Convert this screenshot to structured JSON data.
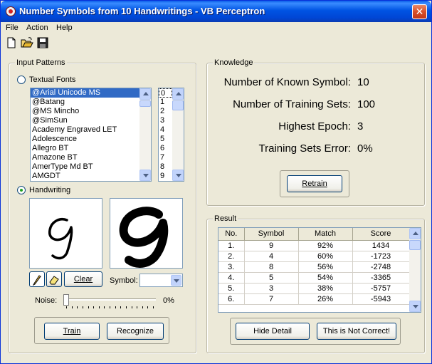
{
  "window": {
    "title": "Number Symbols from 10 Handwritings - VB Perceptron",
    "close_glyph": "✕"
  },
  "menu": {
    "file": "File",
    "action": "Action",
    "help": "Help"
  },
  "toolbar": {
    "icons": [
      "new-file-icon",
      "open-folder-icon",
      "save-disk-icon"
    ]
  },
  "input_patterns": {
    "legend": "Input Patterns",
    "textual_fonts_label": "Textual Fonts",
    "fonts": [
      "@Arial Unicode MS",
      "@Batang",
      "@MS Mincho",
      "@SimSun",
      "Academy Engraved LET",
      "Adolescence",
      "Allegro BT",
      "Amazone BT",
      "AmerType Md BT",
      "AMGDT"
    ],
    "digits": [
      "0",
      "1",
      "2",
      "3",
      "4",
      "5",
      "6",
      "7",
      "8",
      "9"
    ],
    "handwriting_label": "Handwriting",
    "clear_button": "Clear",
    "symbol_label": "Symbol:",
    "symbol_value": "",
    "noise_label": "Noise:",
    "noise_value": "0%",
    "noise_level": 0,
    "train_button": "Train",
    "recognize_button": "Recognize"
  },
  "knowledge": {
    "legend": "Knowledge",
    "rows": [
      {
        "label": "Number of Known Symbol:",
        "value": "10"
      },
      {
        "label": "Number of Training Sets:",
        "value": "100"
      },
      {
        "label": "Highest Epoch:",
        "value": "3"
      },
      {
        "label": "Training Sets Error:",
        "value": "0%"
      }
    ],
    "retrain_button": "Retrain"
  },
  "result": {
    "legend": "Result",
    "columns": [
      "No.",
      "Symbol",
      "Match",
      "Score"
    ],
    "rows": [
      [
        "1.",
        "9",
        "92%",
        "1434"
      ],
      [
        "2.",
        "4",
        "60%",
        "-1723"
      ],
      [
        "3.",
        "8",
        "56%",
        "-2748"
      ],
      [
        "4.",
        "5",
        "54%",
        "-3365"
      ],
      [
        "5.",
        "3",
        "38%",
        "-5757"
      ],
      [
        "6.",
        "7",
        "26%",
        "-5943"
      ]
    ],
    "hide_detail_button": "Hide Detail",
    "not_correct_button": "This is Not Correct!"
  }
}
